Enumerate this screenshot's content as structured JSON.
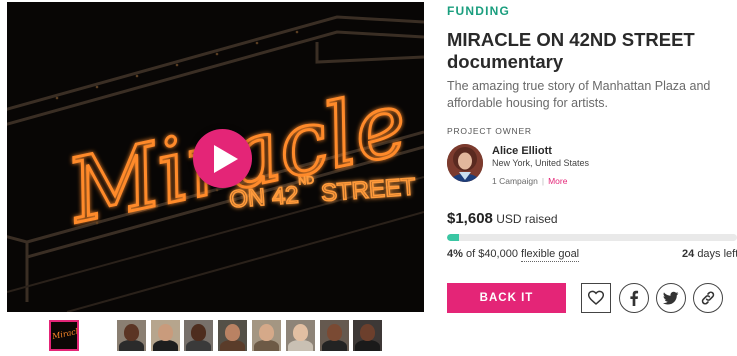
{
  "campaign": {
    "category": "FUNDING",
    "title": "MIRACLE ON 42ND STREET documentary",
    "blurb": "The amazing true story of Manhattan Plaza and affordable housing for artists."
  },
  "media": {
    "poster_text": "Miracle",
    "poster_subtext_on": "ON 42",
    "poster_subtext_nd": "ND",
    "poster_subtext_street": "STREET",
    "play_icon": "play-icon",
    "thumbnails": [
      {
        "label": "Miracle",
        "kind": "title-card"
      },
      {
        "kind": "portrait",
        "skin": "#5b3524",
        "shirt": "#2b2b2b",
        "bg": "#8a7f72"
      },
      {
        "kind": "portrait",
        "skin": "#c99b7c",
        "shirt": "#1e1e1e",
        "bg": "#b6a58d"
      },
      {
        "kind": "portrait",
        "skin": "#4e2d1e",
        "shirt": "#3a3a3a",
        "bg": "#77706a"
      },
      {
        "kind": "portrait",
        "skin": "#b98263",
        "shirt": "#5a3c2a",
        "bg": "#545047"
      },
      {
        "kind": "portrait",
        "skin": "#d5a989",
        "shirt": "#6d5a46",
        "bg": "#a49682"
      },
      {
        "kind": "portrait",
        "skin": "#e2bfa2",
        "shirt": "#c9c0b3",
        "bg": "#8e8478"
      },
      {
        "kind": "portrait",
        "skin": "#7a4a33",
        "shirt": "#232323",
        "bg": "#65594f"
      },
      {
        "kind": "portrait",
        "skin": "#6c3f2c",
        "shirt": "#1a1a1a",
        "bg": "#3d3836"
      }
    ]
  },
  "owner": {
    "heading": "PROJECT OWNER",
    "name": "Alice Elliott",
    "location": "New York, United States",
    "campaigns": "1 Campaign",
    "separator": "|",
    "more": "More"
  },
  "funding": {
    "amount": "$1,608",
    "currency_label": "USD raised",
    "percent_label": "4%",
    "progress": 0.04,
    "goal_prefix": "of $40,000",
    "goal_type": "flexible goal",
    "days_number": "24",
    "days_label": "days left"
  },
  "actions": {
    "back_label": "BACK IT",
    "favorite_icon": "heart-icon",
    "facebook_icon": "facebook-icon",
    "twitter_icon": "twitter-icon",
    "link_icon": "link-icon"
  },
  "colors": {
    "accent": "#e42577",
    "category": "#1a9e7e",
    "progress": "#3ac6a3",
    "neon": "#ff8a2a"
  }
}
